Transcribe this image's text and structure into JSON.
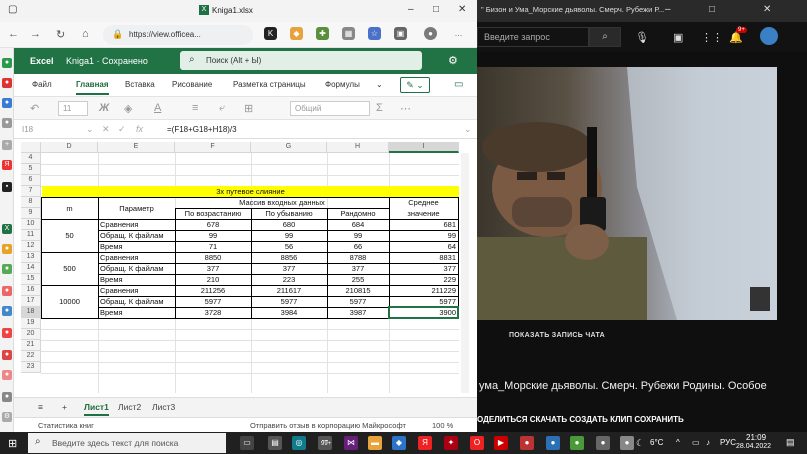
{
  "browser": {
    "tab_title": "Kniga1.xlsx",
    "url": "https://view.officea...",
    "window_buttons": [
      "–",
      "□",
      "✕"
    ]
  },
  "excel": {
    "app_name": "Excel",
    "doc_name": "Kniga1",
    "save_status": "Сохранено",
    "search_placeholder": "Поиск (Alt + Ы)",
    "menu": [
      "Файл",
      "Главная",
      "Вставка",
      "Рисование",
      "Разметка страницы",
      "Формулы"
    ],
    "active_menu": "Главная",
    "ribbon": {
      "font_size": "11",
      "number_format": "Общий"
    },
    "name_box": "I18",
    "formula": "=(F18+G18+H18)/3",
    "columns": [
      "D",
      "E",
      "F",
      "G",
      "H",
      "I"
    ],
    "selected_column": "I",
    "rows": [
      "4",
      "5",
      "6",
      "7",
      "8",
      "9",
      "10",
      "11",
      "12",
      "13",
      "14",
      "15",
      "16",
      "17",
      "18",
      "19",
      "20",
      "21",
      "22",
      "23"
    ],
    "selected_row": "18",
    "table": {
      "banner": "3х путевое слияние",
      "m_header": "m",
      "param_header": "Параметр",
      "massiv_header": "Массив входных данных",
      "sub_headers": [
        "По возрастанию",
        "По убыванию",
        "Рандомно"
      ],
      "avg_header_1": "Среднее",
      "avg_header_2": "значение",
      "groups": [
        {
          "m": "50",
          "rows": [
            {
              "param": "Сравнения",
              "asc": "678",
              "desc": "680",
              "rnd": "684",
              "avg": "681"
            },
            {
              "param": "Обращ. К файлам",
              "asc": "99",
              "desc": "99",
              "rnd": "99",
              "avg": "99"
            },
            {
              "param": "Время",
              "asc": "71",
              "desc": "56",
              "rnd": "66",
              "avg": "64"
            }
          ]
        },
        {
          "m": "500",
          "rows": [
            {
              "param": "Сравнения",
              "asc": "8850",
              "desc": "8856",
              "rnd": "8788",
              "avg": "8831"
            },
            {
              "param": "Обращ. К файлам",
              "asc": "377",
              "desc": "377",
              "rnd": "377",
              "avg": "377"
            },
            {
              "param": "Время",
              "asc": "210",
              "desc": "223",
              "rnd": "255",
              "avg": "229"
            }
          ]
        },
        {
          "m": "10000",
          "rows": [
            {
              "param": "Сравнения",
              "asc": "211256",
              "desc": "211617",
              "rnd": "210815",
              "avg": "211229"
            },
            {
              "param": "Обращ. К файлам",
              "asc": "5977",
              "desc": "5977",
              "rnd": "5977",
              "avg": "5977"
            },
            {
              "param": "Время",
              "asc": "3728",
              "desc": "3984",
              "rnd": "3987",
              "avg": "3900"
            }
          ]
        }
      ]
    },
    "sheets": [
      "Лист1",
      "Лист2",
      "Лист3"
    ],
    "active_sheet": "Лист1",
    "status_left": "Статистика книг",
    "status_mid": "Отправить отзыв в корпорацию Майкрософт",
    "zoom": "100 %"
  },
  "youtube": {
    "window_title": "\" Бизон и Ума_Морские дьяволы. Смерч. Рубежи Р...",
    "search_placeholder": "Введите запрос",
    "notification_count": "9+",
    "show_chat": "ПОКАЗАТЬ ЗАПИСЬ ЧАТА",
    "video_title": "ума_Морские дьяволы. Смерч. Рубежи Родины. Особое",
    "actions": "ОДЕЛИТЬСЯ   СКАЧАТЬ   СОЗДАТЬ КЛИП   СОХРАНИТЬ"
  },
  "taskbar": {
    "search_placeholder": "Введите здесь текст для поиска",
    "badge": "99+",
    "weather": "6°C",
    "lang": "РУС",
    "time": "21:09",
    "date": "28.04.2022"
  },
  "colors": {
    "excel_green": "#217346",
    "banner_yellow": "#ffff00"
  }
}
